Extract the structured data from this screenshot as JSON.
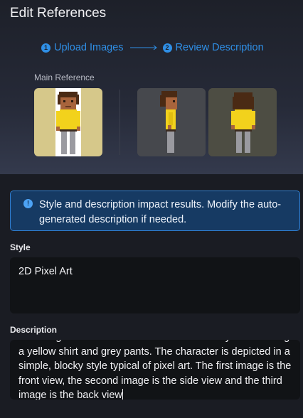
{
  "header": {
    "title": "Edit References"
  },
  "stepper": {
    "steps": [
      {
        "number": "1",
        "label": "Upload Images"
      },
      {
        "number": "2",
        "label": "Review Description"
      }
    ]
  },
  "references": {
    "main_label": "Main Reference",
    "images": [
      "front-view",
      "side-view",
      "back-view"
    ]
  },
  "alert": {
    "icon": "info-icon",
    "message": "Style and description impact results. Modify the auto-generated description if needed."
  },
  "style": {
    "label": "Style",
    "value": "2D Pixel Art"
  },
  "description": {
    "label": "Description",
    "value": "The image shows a character with brown curly hair wearing a yellow shirt and grey pants. The character is depicted in a simple, blocky style typical of pixel art. The first image is the front view, the second image is the side view and the third image is the back view"
  },
  "colors": {
    "accent": "#2f8fe6",
    "alert_bg": "#163a63",
    "alert_border": "#2f7fd3",
    "input_bg": "#111316"
  }
}
